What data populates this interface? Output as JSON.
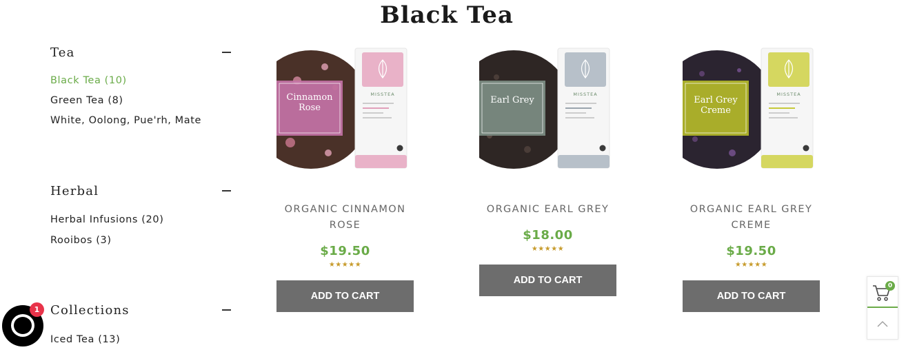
{
  "page": {
    "title": "Black Tea"
  },
  "sidebar": {
    "groups": [
      {
        "title": "Tea",
        "items": [
          {
            "label": "Black Tea (10)",
            "active": true
          },
          {
            "label": "Green Tea (8)"
          },
          {
            "label": "White, Oolong, Pue'rh, Mate"
          }
        ]
      },
      {
        "title": "Herbal",
        "items": [
          {
            "label": "Herbal Infusions (20)"
          },
          {
            "label": "Rooibos (3)"
          }
        ]
      },
      {
        "title": "Collections",
        "items": [
          {
            "label": "Iced Tea (13)"
          }
        ]
      }
    ]
  },
  "products": [
    {
      "name_line1": "ORGANIC CINNAMON",
      "name_line2": "ROSE",
      "price": "$19.50",
      "rating": 5,
      "button": "ADD TO CART",
      "label_line1": "Cinnamon",
      "label_line2": "Rose",
      "label_color": "#c774a8",
      "tin_color": "#e9b2c8",
      "tea_color": "#4a3128"
    },
    {
      "name_line1": "ORGANIC EARL GREY",
      "name_line2": "",
      "price": "$18.00",
      "rating": 5,
      "button": "ADD TO CART",
      "label_line1": "Earl Grey",
      "label_line2": "",
      "label_color": "#7a8a82",
      "tin_color": "#b7c0c9",
      "tea_color": "#2e2624"
    },
    {
      "name_line1": "ORGANIC EARL GREY",
      "name_line2": "CREME",
      "price": "$19.50",
      "rating": 5,
      "button": "ADD TO CART",
      "label_line1": "Earl Grey",
      "label_line2": "Creme",
      "label_color": "#b0b52a",
      "tin_color": "#d5d760",
      "tea_color": "#2b2430"
    }
  ],
  "brand": {
    "tin_brand": "MISSTEA"
  },
  "cart": {
    "count": "0"
  },
  "chat": {
    "badge": "1"
  },
  "colors": {
    "accent": "#6aab48",
    "star": "#c79b2c",
    "button": "#6d6d6d",
    "chat_badge": "#e8334a"
  }
}
